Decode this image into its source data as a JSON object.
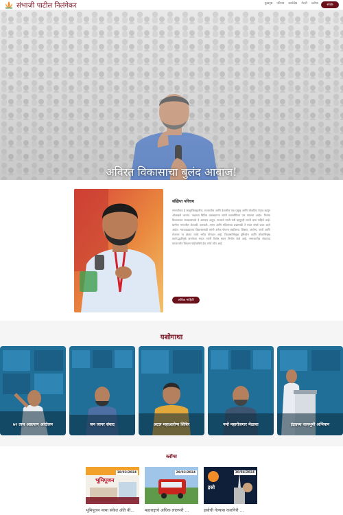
{
  "header": {
    "title": "संभाजी पाटील निलंगेकर",
    "nav": [
      "मुखपृष्ठ",
      "परिचय",
      "कार्यक्षेत्र",
      "गॅलरी",
      "ब्लॉग्स"
    ],
    "contact_label": "संपर्क"
  },
  "hero": {
    "tagline": "अविरत विकासाचा बुलंद आवाज!"
  },
  "about": {
    "heading": "संक्षिप्त परिचय",
    "text": "संभाजीराव हे लातूरजिल्ह्यातील, राज्यातील आणि देशातील एक प्रमुख आणि लोकप्रिय नेतृत्व म्हणून ओळखले जातात. पक्षाच्या विविध जबाबदाऱ्या त्यांनी यशस्वीरित्या पार पाडल्या आहेत. निलंगा विधानसभा मतदारसंघाचे ते आमदार असून, राज्याचे माजी मंत्री म्हणूनही त्यांनी काम पाहिले आहे. ग्रामीण भागातील शेतकरी, कष्टकरी, तरुण आणि महिलांच्या प्रश्नांसाठी ते सतत संघर्ष करत आले आहेत. मराठवाड्याच्या विकासासाठी त्यांनी अनेक योजना राबविल्या. शिक्षण, आरोग्य, पाणी आणि रोजगार या क्षेत्रांत त्यांचे भरीव योगदान आहे. विकासाभिमुख दृष्टिकोन आणि लोकाभिमुख कार्यपद्धतीमुळे जनतेच्या मनात त्यांनी विशेष स्थान निर्माण केले आहे. समाजातील शेवटच्या घटकापर्यंत विकास पोहोचविणे हेच त्यांचे ध्येय आहे.",
    "button_label": "अधिक माहिती"
  },
  "yashogatha": {
    "title": "यशोगाथा",
    "cards": [
      {
        "label": "७२ तास अन्नत्याग आंदोलन"
      },
      {
        "label": "जन जागर संवाद"
      },
      {
        "label": "अटल महाआरोग्य शिबिर"
      },
      {
        "label": "नमो महारोजगार मेळावा"
      },
      {
        "label": "इंद्रप्रस्थ जलभूमी अभियान"
      }
    ],
    "active_dot": 2
  },
  "blogs": {
    "title": "ब्लॉग्स",
    "items": [
      {
        "date": "18/03/2024",
        "caption": "भूमिपूजन नव्या संकेत अंति बी...",
        "banner": "भूमिपूजन"
      },
      {
        "date": "29/03/2024",
        "caption": "महाराष्ट्राचे अधिक लालपरी ...",
        "banner": ""
      },
      {
        "date": "30/04/2024",
        "caption": "इस्रोची गेल्यास कारगिरी ...",
        "banner": "इस्रो"
      }
    ]
  },
  "colors": {
    "brand": "#7a1020",
    "button": "#6b0f1a",
    "card_blue": "#1f6f99"
  }
}
